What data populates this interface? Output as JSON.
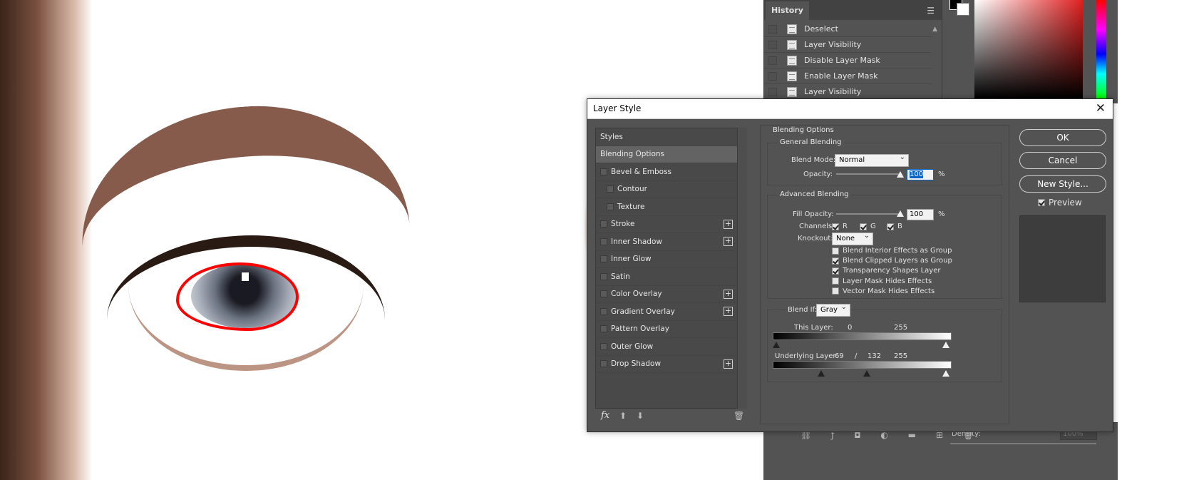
{
  "history": {
    "tab_label": "History",
    "items": [
      "Deselect",
      "Layer Visibility",
      "Disable Layer Mask",
      "Enable Layer Mask",
      "Layer Visibility"
    ]
  },
  "bottom": {
    "density_label": "Density:",
    "density_value": "100%"
  },
  "dialog": {
    "title": "Layer Style",
    "close_glyph": "✕",
    "styles_header": "Styles",
    "styles": [
      {
        "label": "Blending Options",
        "selected": true
      },
      {
        "label": "Bevel & Emboss",
        "checkbox": true
      },
      {
        "label": "Contour",
        "checkbox": true,
        "indent": true
      },
      {
        "label": "Texture",
        "checkbox": true,
        "indent": true
      },
      {
        "label": "Stroke",
        "checkbox": true,
        "plus": true
      },
      {
        "label": "Inner Shadow",
        "checkbox": true,
        "plus": true
      },
      {
        "label": "Inner Glow",
        "checkbox": true
      },
      {
        "label": "Satin",
        "checkbox": true
      },
      {
        "label": "Color Overlay",
        "checkbox": true,
        "plus": true
      },
      {
        "label": "Gradient Overlay",
        "checkbox": true,
        "plus": true
      },
      {
        "label": "Pattern Overlay",
        "checkbox": true
      },
      {
        "label": "Outer Glow",
        "checkbox": true
      },
      {
        "label": "Drop Shadow",
        "checkbox": true,
        "plus": true
      }
    ],
    "footer": {
      "fx": "fx",
      "up": "⬆",
      "down": "⬇",
      "trash": "🗑"
    },
    "blending_options_title": "Blending Options",
    "general_blending_title": "General Blending",
    "blend_mode_label": "Blend Mode:",
    "blend_mode_value": "Normal",
    "opacity_label": "Opacity:",
    "opacity_value": "100",
    "percent": "%",
    "advanced_blending_title": "Advanced Blending",
    "fill_opacity_label": "Fill Opacity:",
    "fill_opacity_value": "100",
    "channels_label": "Channels:",
    "channels": [
      "R",
      "G",
      "B"
    ],
    "knockout_label": "Knockout:",
    "knockout_value": "None",
    "advanced_checks": [
      {
        "label": "Blend Interior Effects as Group",
        "checked": false
      },
      {
        "label": "Blend Clipped Layers as Group",
        "checked": true
      },
      {
        "label": "Transparency Shapes Layer",
        "checked": true
      },
      {
        "label": "Layer Mask Hides Effects",
        "checked": false
      },
      {
        "label": "Vector Mask Hides Effects",
        "checked": false
      }
    ],
    "blend_if_label": "Blend If:",
    "blend_if_value": "Gray",
    "this_layer_label": "This Layer:",
    "this_layer_low": "0",
    "this_layer_high": "255",
    "underlying_label": "Underlying Layer:",
    "underlying_low": "69",
    "underlying_sep": "/",
    "underlying_mid": "132",
    "underlying_high": "255",
    "buttons": {
      "ok": "OK",
      "cancel": "Cancel",
      "new_style": "New Style..."
    },
    "preview_label": "Preview",
    "preview_checked": true
  },
  "colors": {
    "panel_bg": "#535353",
    "annotation": "#ff0000"
  }
}
